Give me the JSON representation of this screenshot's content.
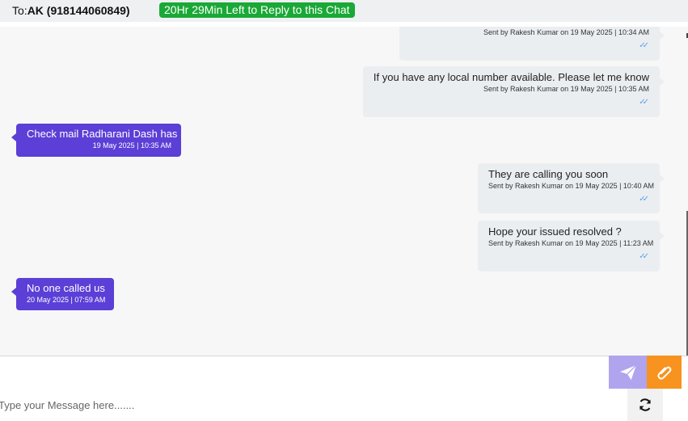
{
  "header": {
    "to_label": "To:",
    "recipient": "AK (918144060849)",
    "reply_window": "20Hr 29Min Left to Reply to this Chat"
  },
  "messages": [
    {
      "direction": "out",
      "text": "",
      "meta": "Sent by Rakesh Kumar on 19 May 2025 | 10:34 AM",
      "ticks": "✓✓"
    },
    {
      "direction": "out",
      "text": "If you have any local number available. Please let me know",
      "meta": "Sent by Rakesh Kumar on 19 May 2025 | 10:35 AM",
      "ticks": "✓✓"
    },
    {
      "direction": "in",
      "text": "Check mail Radharani Dash has .",
      "meta": "19 May 2025 | 10:35 AM"
    },
    {
      "direction": "out",
      "text": "They are calling you soon",
      "meta": "Sent by Rakesh Kumar on 19 May 2025 | 10:40 AM",
      "ticks": "✓✓"
    },
    {
      "direction": "out",
      "text": "Hope your issued resolved ?",
      "meta": "Sent by Rakesh Kumar on 19 May 2025 | 11:23 AM",
      "ticks": "✓✓"
    },
    {
      "direction": "in",
      "text": "No one called us",
      "meta": "20 May 2025 | 07:59 AM"
    }
  ],
  "composer": {
    "placeholder": "Type your Message here......."
  },
  "icons": {
    "send": "paper-plane-icon",
    "attach": "paperclip-icon",
    "refresh": "refresh-icon"
  },
  "colors": {
    "header_bg": "#eef0f2",
    "timer_bg": "#1aa836",
    "incoming_bubble": "#5b3fd6",
    "outgoing_bubble": "#ebeef1",
    "send_button": "#b1a4ee",
    "attach_button": "#f7931e",
    "read_tick": "#5aa0e8"
  }
}
